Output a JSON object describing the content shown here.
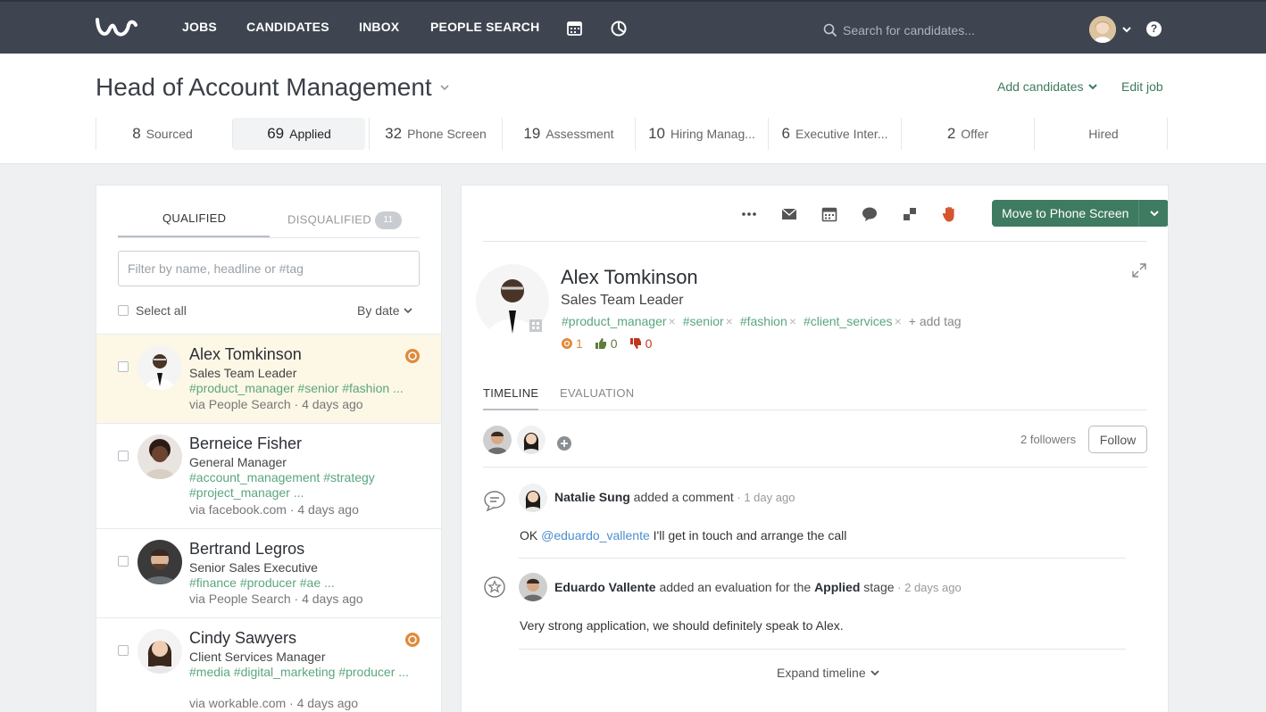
{
  "topbar": {
    "logo": "workable-logo",
    "nav": [
      "JOBS",
      "CANDIDATES",
      "INBOX",
      "PEOPLE SEARCH"
    ],
    "search_placeholder": "Search for candidates...",
    "help": "?"
  },
  "job": {
    "title": "Head of Account Management",
    "add_candidates": "Add candidates",
    "edit_job": "Edit job"
  },
  "stages": [
    {
      "count": "8",
      "label": "Sourced"
    },
    {
      "count": "69",
      "label": "Applied"
    },
    {
      "count": "32",
      "label": "Phone Screen"
    },
    {
      "count": "19",
      "label": "Assessment"
    },
    {
      "count": "10",
      "label": "Hiring Manag..."
    },
    {
      "count": "6",
      "label": "Executive Inter..."
    },
    {
      "count": "2",
      "label": "Offer"
    },
    {
      "count": "",
      "label": "Hired"
    }
  ],
  "list": {
    "tab_qualified": "QUALIFIED",
    "tab_disqualified": "DISQUALIFIED",
    "disqualified_count": "11",
    "filter_placeholder": "Filter by name, headline or #tag",
    "select_all": "Select all",
    "sort": "By date",
    "candidates": [
      {
        "name": "Alex Tomkinson",
        "headline": "Sales Team Leader",
        "tags": "#product_manager #senior #fashion ...",
        "source": "via People Search · 4 days ago"
      },
      {
        "name": "Berneice Fisher",
        "headline": "General Manager",
        "tags": "#account_management #strategy  #project_manager ...",
        "source": "via facebook.com · 4 days ago"
      },
      {
        "name": "Bertrand Legros",
        "headline": "Senior Sales Executive",
        "tags": "#finance #producer #ae ...",
        "source": "via People Search · 4 days ago"
      },
      {
        "name": "Cindy Sawyers",
        "headline": "Client Services Manager",
        "tags": "#media #digital_marketing #producer ...",
        "source": "via workable.com · 4 days ago"
      }
    ]
  },
  "profile": {
    "move_button": "Move to Phone Screen",
    "name": "Alex Tomkinson",
    "headline": "Sales Team Leader",
    "tags": [
      "#product_manager",
      "#senior",
      "#fashion",
      "#client_services"
    ],
    "add_tag": "+ add tag",
    "stats": {
      "stars": "1",
      "thumbs_up": "0",
      "thumbs_down": "0"
    },
    "tab_timeline": "TIMELINE",
    "tab_evaluation": "EVALUATION",
    "followers": "2 followers",
    "follow_button": "Follow",
    "events": [
      {
        "author": "Natalie Sung",
        "action": " added a comment",
        "time": " · 1 day ago",
        "body_prefix": "OK ",
        "mention": "@eduardo_vallente",
        "body_suffix": " I'll get in touch and arrange the call"
      },
      {
        "author": "Eduardo Vallente",
        "action": " added an evaluation for the ",
        "stage": "Applied",
        "action2": " stage",
        "time": " · 2 days ago",
        "body": "Very strong application, we should definitely speak to Alex."
      }
    ],
    "expand_timeline": "Expand timeline"
  },
  "colors": {
    "topbar": "#3e4550",
    "accent_green": "#3f7b61",
    "tag_green": "#5aa67d",
    "star_orange": "#e08a3c",
    "selected_row": "#fdf7e6"
  }
}
